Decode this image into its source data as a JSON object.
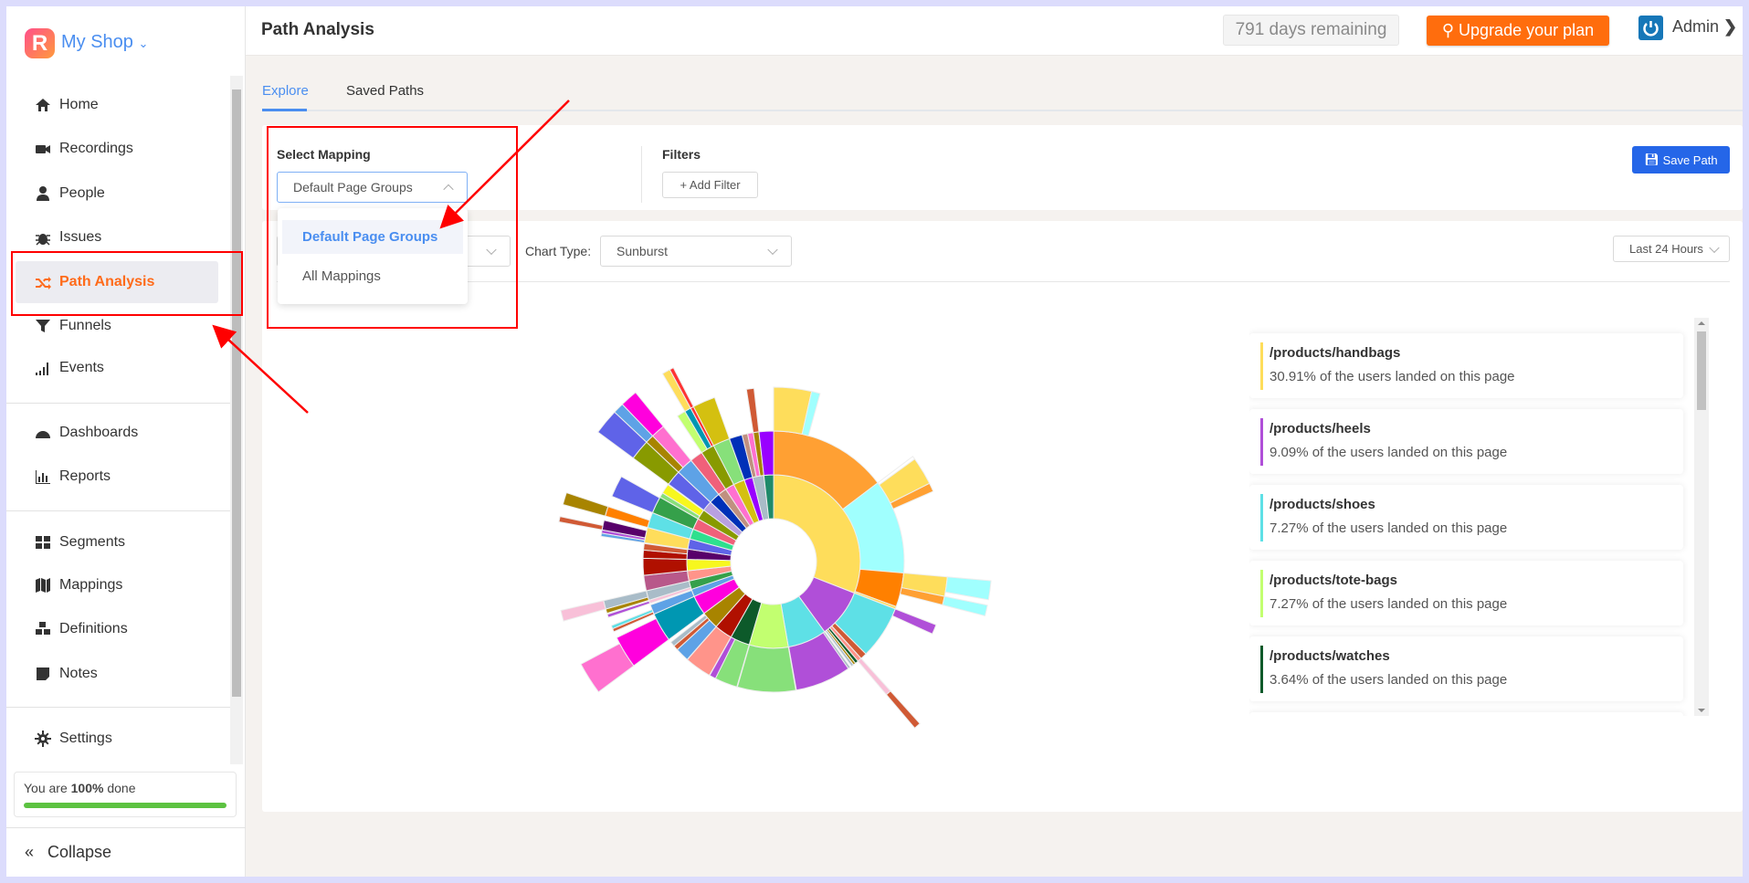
{
  "app": {
    "shop_name": "My Shop",
    "logo_letter": "R"
  },
  "sidebar": {
    "items": [
      {
        "label": "Home",
        "icon": "home-icon"
      },
      {
        "label": "Recordings",
        "icon": "video-camera-icon"
      },
      {
        "label": "People",
        "icon": "user-icon"
      },
      {
        "label": "Issues",
        "icon": "bug-icon"
      },
      {
        "label": "Path Analysis",
        "icon": "shuffle-icon",
        "active": true
      },
      {
        "label": "Funnels",
        "icon": "funnel-icon"
      },
      {
        "label": "Events",
        "icon": "signal-bars-icon"
      },
      {
        "label": "Dashboards",
        "icon": "dashboard-gauge-icon"
      },
      {
        "label": "Reports",
        "icon": "bar-chart-icon"
      },
      {
        "label": "Segments",
        "icon": "grid-icon"
      },
      {
        "label": "Mappings",
        "icon": "map-icon"
      },
      {
        "label": "Definitions",
        "icon": "cubes-icon"
      },
      {
        "label": "Notes",
        "icon": "sticky-note-icon"
      },
      {
        "label": "Settings",
        "icon": "gear-icon"
      }
    ],
    "progress": {
      "prefix": "You are ",
      "value": "100%",
      "suffix": " done",
      "percent": 100
    },
    "collapse_label": "Collapse"
  },
  "header": {
    "title": "Path Analysis",
    "days_remaining": "791 days remaining",
    "upgrade_label": "Upgrade your plan",
    "user": "Admin"
  },
  "tabs": [
    {
      "label": "Explore",
      "active": true
    },
    {
      "label": "Saved Paths"
    }
  ],
  "filters": {
    "mapping_label": "Select Mapping",
    "mapping_value": "Default Page Groups",
    "mapping_options": [
      "Default Page Groups",
      "All Mappings"
    ],
    "filters_label": "Filters",
    "add_filter": "+ Add Filter",
    "save_path": "Save Path"
  },
  "chart_controls": {
    "chart_type_label": "Chart Type:",
    "chart_type_value": "Sunburst",
    "time_range": "Last 24 Hours"
  },
  "legend": [
    {
      "page": "/products/handbags",
      "text": "30.91% of the users landed on this page",
      "color": "#fedd5b"
    },
    {
      "page": "/products/heels",
      "text": "9.09% of the users landed on this page",
      "color": "#b04fd8"
    },
    {
      "page": "/products/shoes",
      "text": "7.27% of the users landed on this page",
      "color": "#5ee0e6"
    },
    {
      "page": "/products/tote-bags",
      "text": "7.27% of the users landed on this page",
      "color": "#c2ff70"
    },
    {
      "page": "/products/watches",
      "text": "3.64% of the users landed on this page",
      "color": "#0d5a2a"
    },
    {
      "color": "#b01000"
    }
  ],
  "colors": {
    "accent": "#ff6b1a",
    "link": "#4a8ef0",
    "primary_button": "#2566e8",
    "upgrade": "#ff6d0d",
    "annotation": "#ff0000"
  },
  "chart_data": {
    "type": "sunburst",
    "unit": "percent of users",
    "nodes": [
      {
        "name": "/products/handbags",
        "v": 30.91,
        "c": "#fedd5b",
        "children": [
          {
            "v": 14.7,
            "c": "#ffa033",
            "children": [
              {
                "v": 3.5,
                "c": "#fedd5b"
              },
              {
                "v": 0.8,
                "c": "#a0fffe"
              }
            ]
          },
          {
            "v": 11.7,
            "c": "#a0fffe",
            "children": [
              {
                "v": 0.3,
                "c": "#ffffff"
              },
              {
                "v": 2.6,
                "c": "#fedd5b"
              },
              {
                "v": 0.8,
                "c": "#ffa033"
              }
            ]
          },
          {
            "v": 4.2,
            "c": "#ff8000",
            "children": [
              {
                "v": 1.8,
                "c": "#fedd5b",
                "children": [
                  {
                    "v": 1.4,
                    "c": "#a0fffe"
                  }
                ]
              },
              {
                "v": 0.8,
                "c": "#ffa033",
                "children": [
                  {
                    "v": 0.8,
                    "c": "#a0fffe"
                  }
                ]
              }
            ]
          },
          {
            "v": 0.3,
            "c": "#fedd5b"
          }
        ]
      },
      {
        "name": "/products/heels",
        "v": 9.09,
        "c": "#b04fd8",
        "children": [
          {
            "v": 6.6,
            "c": "#5ee0e6",
            "children": [
              {
                "v": 0.9,
                "c": "#b04fd8"
              }
            ]
          },
          {
            "v": 0.8,
            "c": "#d05a35"
          },
          {
            "v": 0.5,
            "c": "#ff948a",
            "children": [
              {
                "v": 0.5,
                "c": "#f8c0d8",
                "children": [
                  {
                    "v": 0.5,
                    "c": "#d05a35"
                  }
                ]
              }
            ]
          },
          {
            "v": 0.4,
            "c": "#0d5a2a"
          },
          {
            "v": 0.3,
            "c": "#a88400"
          },
          {
            "v": 0.3,
            "c": "#a9bcc8"
          }
        ]
      },
      {
        "name": "/products/shoes",
        "v": 7.27,
        "c": "#5ee0e6",
        "children": [
          {
            "v": 0.3,
            "c": "#a9bcc8"
          },
          {
            "v": 6.9,
            "c": "#b04fd8"
          }
        ]
      },
      {
        "name": "/products/tote-bags",
        "v": 7.27,
        "c": "#c2ff70",
        "children": [
          {
            "v": 7.2,
            "c": "#87e07a"
          }
        ]
      },
      {
        "name": "/products/watches",
        "v": 3.64,
        "c": "#0d5a2a",
        "children": [
          {
            "v": 2.8,
            "c": "#87e07a"
          },
          {
            "v": 0.8,
            "c": "#b04fd8"
          }
        ]
      },
      {
        "v": 3.33,
        "c": "#b01000",
        "children": [
          {
            "v": 3.3,
            "c": "#ff948a"
          }
        ]
      },
      {
        "v": 3.3,
        "c": "#a88400",
        "children": [
          {
            "v": 1.7,
            "c": "#5ea2e6"
          },
          {
            "v": 0.6,
            "c": "#d05a35"
          },
          {
            "v": 0.6,
            "c": "#a9bcc8"
          }
        ]
      },
      {
        "v": 3.6,
        "c": "#ff00dd",
        "children": [
          {
            "v": 3.6,
            "c": "#0097b2",
            "children": [
              {
                "v": 3.0,
                "c": "#ff00dd",
                "children": [
                  {
                    "v": 2.4,
                    "c": "#ff70cf"
                  }
                ]
              }
            ]
          }
        ]
      },
      {
        "v": 1.4,
        "c": "#5ea2e6",
        "children": [
          {
            "v": 1.2,
            "c": "#5ea2e6",
            "children": [
              {
                "v": 0.3,
                "c": "#d05a35"
              },
              {
                "v": 0.3,
                "c": "#5ee0e6"
              }
            ]
          }
        ]
      },
      {
        "v": 1.6,
        "c": "#35a04a",
        "children": [
          {
            "v": 0.4,
            "c": "#f8c0d8",
            "children": [
              {
                "v": 0.3,
                "c": "#b04fd8"
              }
            ]
          },
          {
            "v": 1.2,
            "c": "#a9bcc8",
            "children": [
              {
                "v": 0.4,
                "c": "#a88400"
              },
              {
                "v": 0.8,
                "c": "#a9bcc8",
                "children": [
                  {
                    "v": 0.8,
                    "c": "#f8c0d8"
                  }
                ]
              }
            ]
          }
        ]
      },
      {
        "v": 1.9,
        "c": "#ff948a",
        "children": [
          {
            "v": 1.9,
            "c": "#b8588a"
          }
        ]
      },
      {
        "v": 2.1,
        "c": "#f7f71e",
        "children": [
          {
            "v": 2.1,
            "c": "#b01000"
          }
        ]
      },
      {
        "v": 1.9,
        "c": "#58006a",
        "children": [
          {
            "v": 1.0,
            "c": "#b01000"
          },
          {
            "v": 0.8,
            "c": "#d05a35"
          }
        ]
      },
      {
        "v": 1.9,
        "c": "#5f63e8",
        "children": [
          {
            "v": 1.9,
            "c": "#fedd5b",
            "children": [
              {
                "v": 0.3,
                "c": "#5ea2e6"
              },
              {
                "v": 0.3,
                "c": "#b04fd8"
              },
              {
                "v": 0.9,
                "c": "#58006a",
                "children": [
                  {
                    "v": 0.4,
                    "c": "#d05a35"
                  }
                ]
              }
            ]
          }
        ]
      },
      {
        "v": 1.9,
        "c": "#2ee08e",
        "children": [
          {
            "v": 1.9,
            "c": "#5ee0e6",
            "children": [
              {
                "v": 0.9,
                "c": "#ff8000",
                "children": [
                  {
                    "v": 0.9,
                    "c": "#a88400"
                  }
                ]
              }
            ]
          }
        ]
      },
      {
        "v": 2.1,
        "c": "#f0607a",
        "children": [
          {
            "v": 2.1,
            "c": "#35a04a",
            "children": [
              {
                "v": 2.0,
                "c": "#5f63e8"
              }
            ]
          }
        ]
      },
      {
        "v": 1.9,
        "c": "#889a00",
        "children": [
          {
            "v": 0.6,
            "c": "#87e07a"
          },
          {
            "v": 1.2,
            "c": "#f7f71e"
          }
        ]
      },
      {
        "v": 1.9,
        "c": "#b8a0e0",
        "children": [
          {
            "v": 1.9,
            "c": "#5f63e8",
            "children": [
              {
                "v": 1.9,
                "c": "#889a00",
                "children": [
                  {
                    "v": 1.9,
                    "c": "#5f63e8"
                  }
                ]
              }
            ]
          }
        ]
      },
      {
        "v": 2.1,
        "c": "#0030b8",
        "children": [
          {
            "v": 2.1,
            "c": "#5ea2e6",
            "children": [
              {
                "v": 0.8,
                "c": "#a88400",
                "children": [
                  {
                    "v": 0.8,
                    "c": "#5ea2e6"
                  }
                ]
              },
              {
                "v": 1.3,
                "c": "#ff70cf",
                "children": [
                  {
                    "v": 1.3,
                    "c": "#ff00dd"
                  }
                ]
              }
            ]
          }
        ]
      },
      {
        "v": 1.6,
        "c": "#c09080",
        "children": [
          {
            "v": 1.6,
            "c": "#f0607a"
          }
        ]
      },
      {
        "v": 1.7,
        "c": "#ff70cf",
        "children": [
          {
            "v": 1.7,
            "c": "#889a00",
            "children": [
              {
                "v": 0.8,
                "c": "#c2ff70"
              },
              {
                "v": 0.6,
                "c": "#0097b2",
                "children": [
                  {
                    "v": 0.6,
                    "c": "#fedd5b"
                  }
                ]
              },
              {
                "v": 0.3,
                "c": "#ff3333",
                "children": [
                  {
                    "v": 0.3,
                    "c": "#ff3333"
                  }
                ]
              }
            ]
          }
        ]
      },
      {
        "v": 2.1,
        "c": "#d4c010",
        "children": [
          {
            "v": 2.1,
            "c": "#87e07a",
            "children": [
              {
                "v": 2.1,
                "c": "#d4c010"
              }
            ]
          }
        ]
      },
      {
        "v": 1.6,
        "c": "#9900ff",
        "children": [
          {
            "v": 1.6,
            "c": "#0030b8"
          }
        ]
      },
      {
        "v": 2.1,
        "c": "#a9bcc8",
        "children": [
          {
            "v": 0.7,
            "c": "#c09080"
          },
          {
            "v": 0.7,
            "c": "#ff70cf"
          },
          {
            "v": 0.7,
            "c": "#a88400",
            "children": [
              {
                "v": 0.7,
                "c": "#d05a35"
              }
            ]
          }
        ]
      },
      {
        "v": 1.81,
        "c": "#1e8a6a",
        "children": [
          {
            "v": 1.8,
            "c": "#9900ff"
          }
        ]
      }
    ]
  }
}
